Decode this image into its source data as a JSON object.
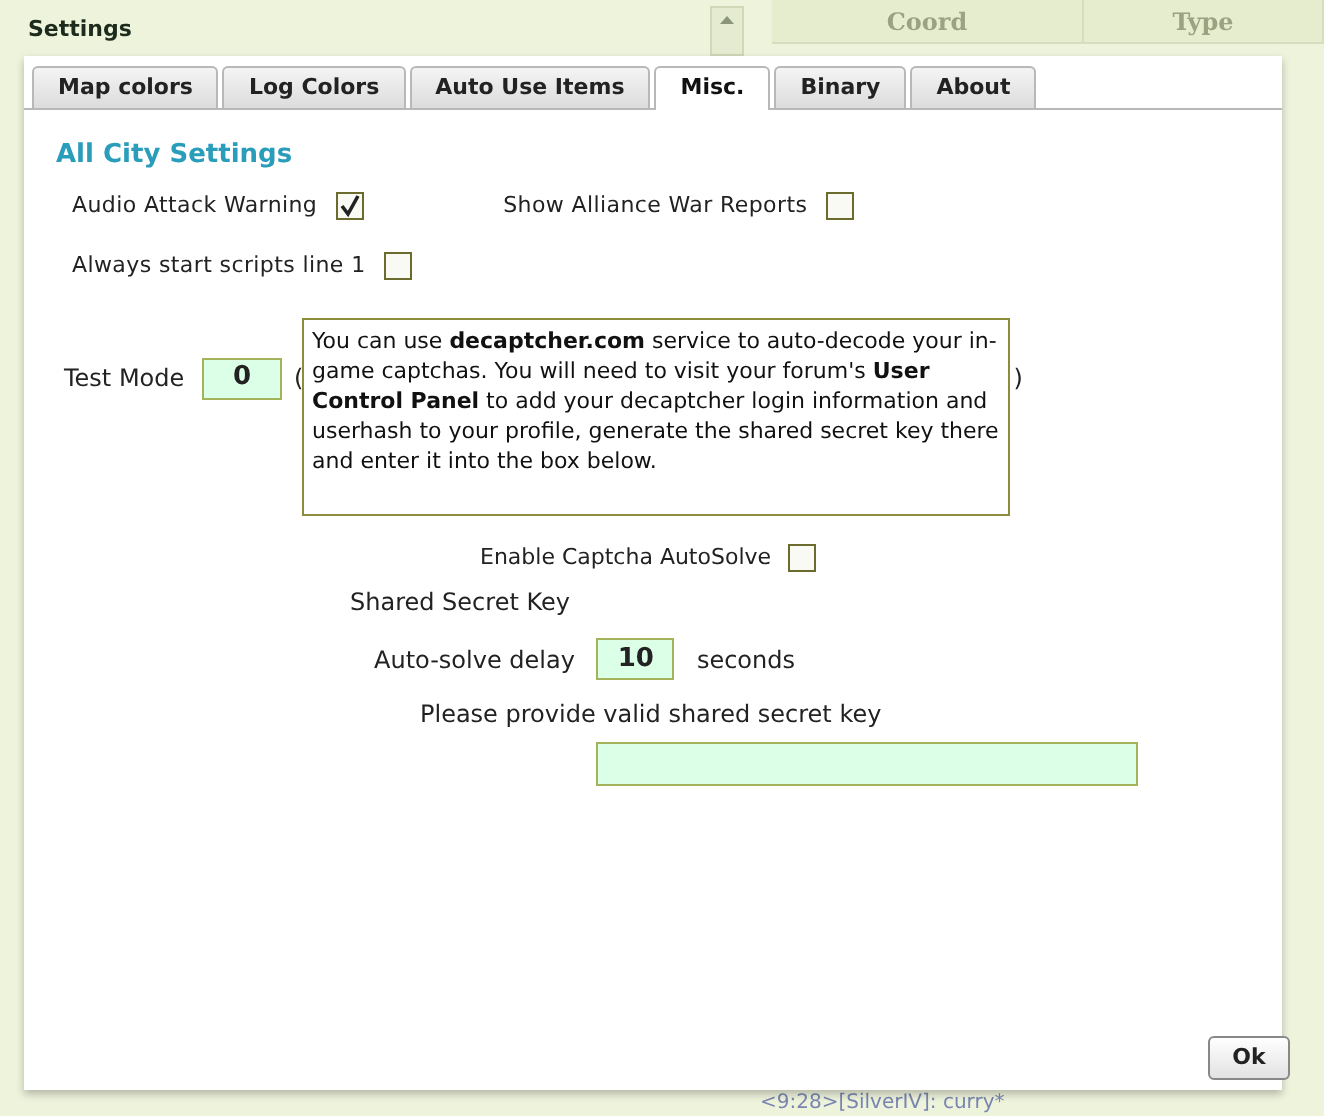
{
  "background": {
    "window_title": "Settings",
    "columns": [
      "Coord",
      "Type"
    ],
    "chat_line": "<9:28>[SilverIV]: curry*"
  },
  "tabs": [
    {
      "label": "Map colors",
      "selected": false
    },
    {
      "label": "Log Colors",
      "selected": false
    },
    {
      "label": "Auto Use Items",
      "selected": false
    },
    {
      "label": "Misc.",
      "selected": true
    },
    {
      "label": "Binary",
      "selected": false
    },
    {
      "label": "About",
      "selected": false
    }
  ],
  "section_title": "All City Settings",
  "options": [
    {
      "label": "Audio Attack Warning",
      "checked": true
    },
    {
      "label": "Show Alliance War Reports",
      "checked": false
    },
    {
      "label": "Always start scripts line 1",
      "checked": false
    }
  ],
  "test_mode": {
    "label": "Test Mode",
    "value": "0",
    "note_open": "(",
    "note_close": ")"
  },
  "tooltip": "You can use **decaptcher.com** service to auto-decode your in-game captchas. You will need to visit your forum's **User Control Panel** to add your decaptcher login information and userhash to your profile, generate the shared secret key there and enter it into the box below.",
  "captcha": {
    "label": "Enable Captcha AutoSolve",
    "checked": false
  },
  "shared_secret_label": "Shared Secret Key",
  "delay": {
    "label": "Auto-solve delay",
    "value": "10",
    "unit": "seconds"
  },
  "key_hint": "Please provide valid shared secret key",
  "ok_button": "Ok"
}
